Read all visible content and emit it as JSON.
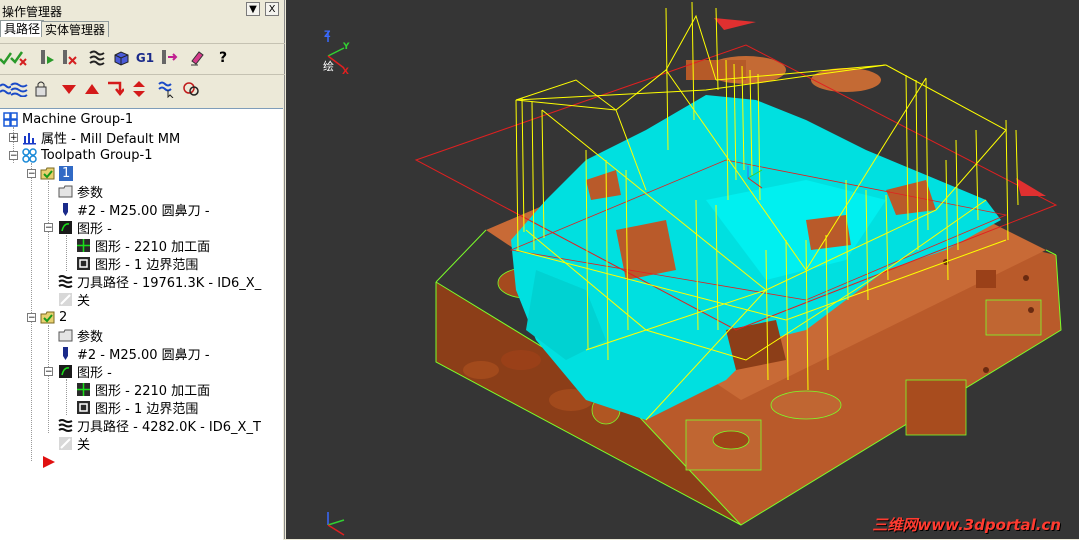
{
  "panel": {
    "title": "操作管理器",
    "pin_glyph": "▼",
    "close_glyph": "X",
    "tabs": [
      {
        "label": "具路径"
      },
      {
        "label": "实体管理器"
      }
    ],
    "toolbar_g1_label": "G1",
    "toolbar_help_label": "?"
  },
  "tree": {
    "machine_group": "Machine Group-1",
    "properties": "属性 - Mill Default MM",
    "toolpath_group": "Toolpath Group-1",
    "ops": [
      {
        "id": "1",
        "params": "参数",
        "tool": "#2 - M25.00 圆鼻刀 -",
        "geometry": "图形 -",
        "geom_a": "图形 - 2210 加工面",
        "geom_b": "图形 - 1 边界范围",
        "toolpath": "刀具路径 - 19761.3K - ID6_X_",
        "off": "关"
      },
      {
        "id": "2",
        "params": "参数",
        "tool": "#2 - M25.00 圆鼻刀 -",
        "geometry": "图形 -",
        "geom_a": "图形 - 2210 加工面",
        "geom_b": "图形 - 1 边界范围",
        "toolpath": "刀具路径 - 4282.0K - ID6_X_T",
        "off": "关"
      }
    ]
  },
  "viewport": {
    "view_label": "绘",
    "axis_z": "Z",
    "axis_y": "Y",
    "axis_x": "X",
    "watermark": "三维网www.3dportal.cn",
    "colors": {
      "background": "#353535",
      "part": "#b95a2a",
      "toolpath_fill": "#00e0e0",
      "rapid_moves": "#ffff00",
      "boundary": "#ff3030",
      "edges": "#7cff2a"
    }
  }
}
